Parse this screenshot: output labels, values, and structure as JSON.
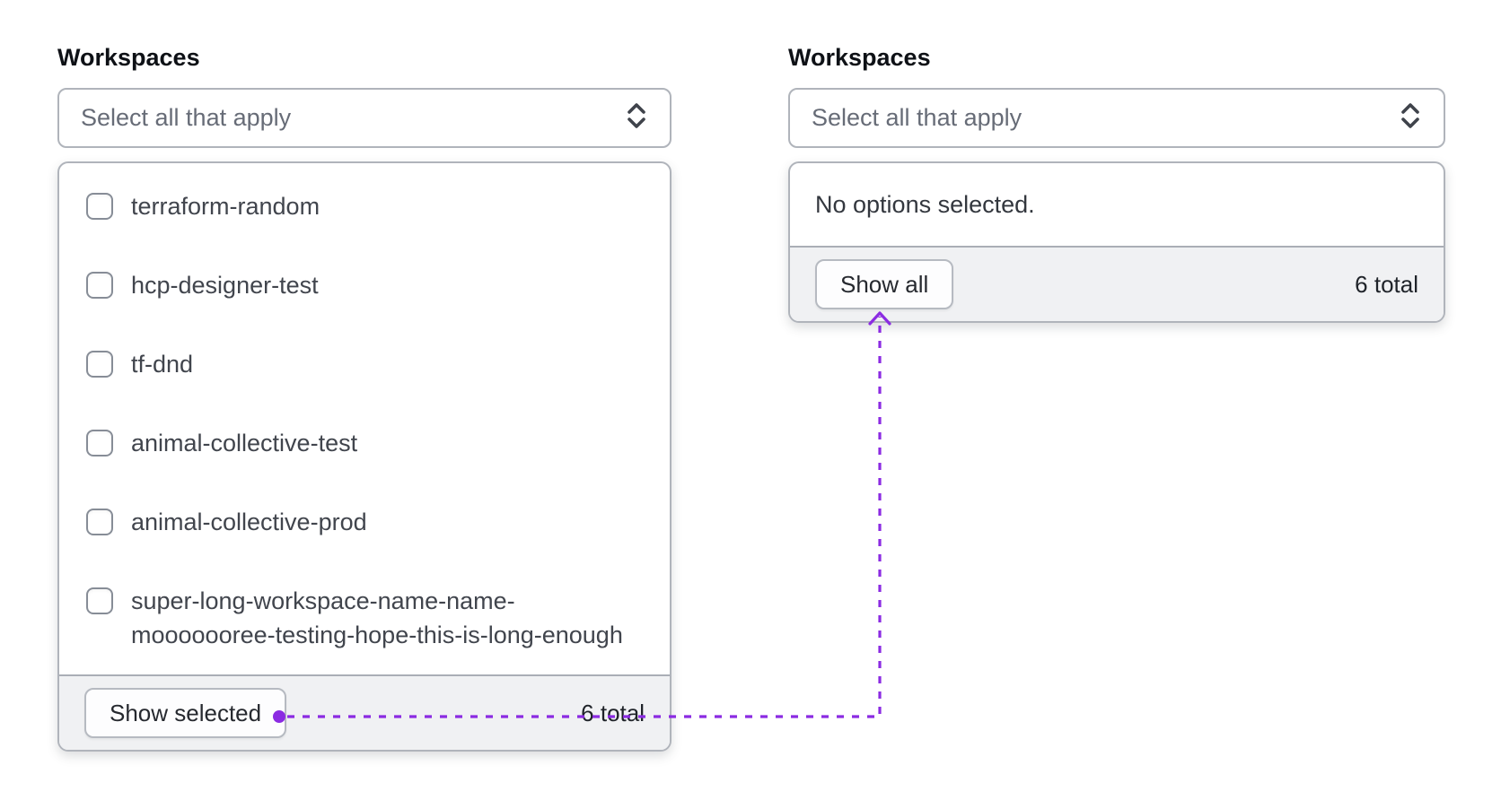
{
  "left_panel": {
    "label": "Workspaces",
    "select_placeholder": "Select all that apply",
    "options": [
      {
        "label": "terraform-random",
        "checked": false
      },
      {
        "label": "hcp-designer-test",
        "checked": false
      },
      {
        "label": "tf-dnd",
        "checked": false
      },
      {
        "label": "animal-collective-test",
        "checked": false
      },
      {
        "label": "animal-collective-prod",
        "checked": false
      },
      {
        "label": "super-long-workspace-name-name-mooooooree-testing-hope-this-is-long-enough",
        "label_lines": [
          "super-long-workspace-name-name-",
          "mooooooree-testing-hope-this-is-long-enough"
        ],
        "checked": false
      }
    ],
    "footer": {
      "button_label": "Show selected",
      "total": "6 total"
    }
  },
  "right_panel": {
    "label": "Workspaces",
    "select_placeholder": "Select all that apply",
    "empty_message": "No options selected.",
    "footer": {
      "button_label": "Show all",
      "total": "6 total"
    }
  },
  "annotation": {
    "color": "#8b2be2",
    "style": "dotted-connector from Show selected to Show all"
  },
  "colors": {
    "border": "#b0b4bb",
    "footer_background": "#f0f1f3",
    "text_primary": "#41454d",
    "placeholder": "#676c77",
    "accent_purple": "#8b2be2"
  }
}
